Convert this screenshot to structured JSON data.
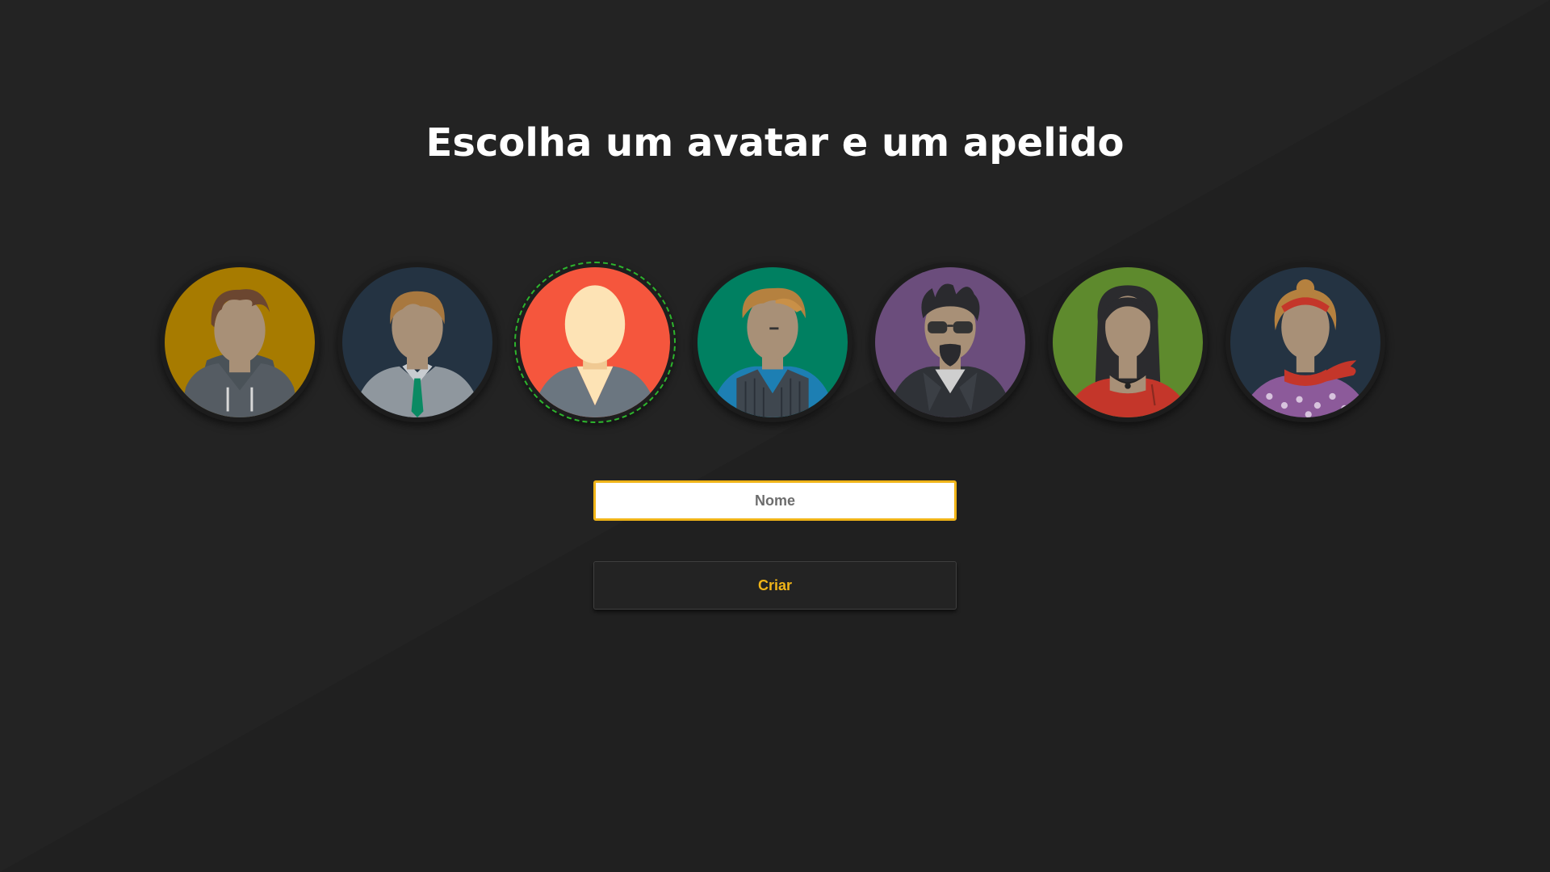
{
  "title": "Escolha um avatar e um apelido",
  "avatars": [
    {
      "icon": "avatar-hoodie-boy-icon",
      "bg": "#a77b00",
      "selected": false
    },
    {
      "icon": "avatar-businessman-icon",
      "bg": "#243342",
      "selected": false
    },
    {
      "icon": "avatar-default-person-icon",
      "bg": "#f5563d",
      "selected": true
    },
    {
      "icon": "avatar-vest-man-icon",
      "bg": "#008061",
      "selected": false
    },
    {
      "icon": "avatar-rocker-sunglasses-icon",
      "bg": "#6b4d7c",
      "selected": false
    },
    {
      "icon": "avatar-long-hair-woman-icon",
      "bg": "#5e8a2d",
      "selected": false
    },
    {
      "icon": "avatar-scarf-woman-icon",
      "bg": "#243342",
      "selected": false
    }
  ],
  "form": {
    "name_placeholder": "Nome",
    "create_label": "Criar"
  },
  "colors": {
    "background": "#232323",
    "accent": "#f0b418",
    "selected_ring": "#2db52d",
    "skin": "#a89077",
    "skin_default": "#fde3b5"
  }
}
